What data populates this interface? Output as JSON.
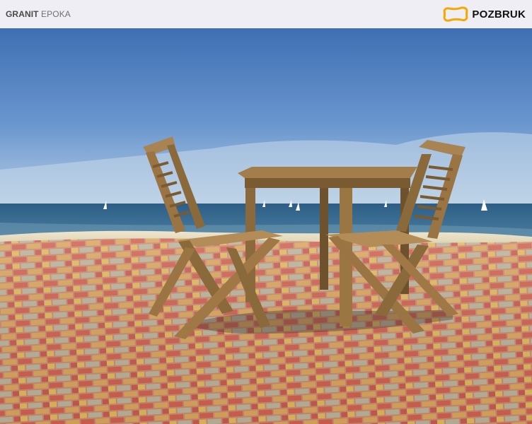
{
  "header": {
    "product_line": "GRANIT",
    "product_name": "EPOKA",
    "brand_name": "POZBRUK",
    "brand_logo_color": "#f5a800"
  },
  "photo": {
    "description_icon": "beach-terrace-photo"
  }
}
